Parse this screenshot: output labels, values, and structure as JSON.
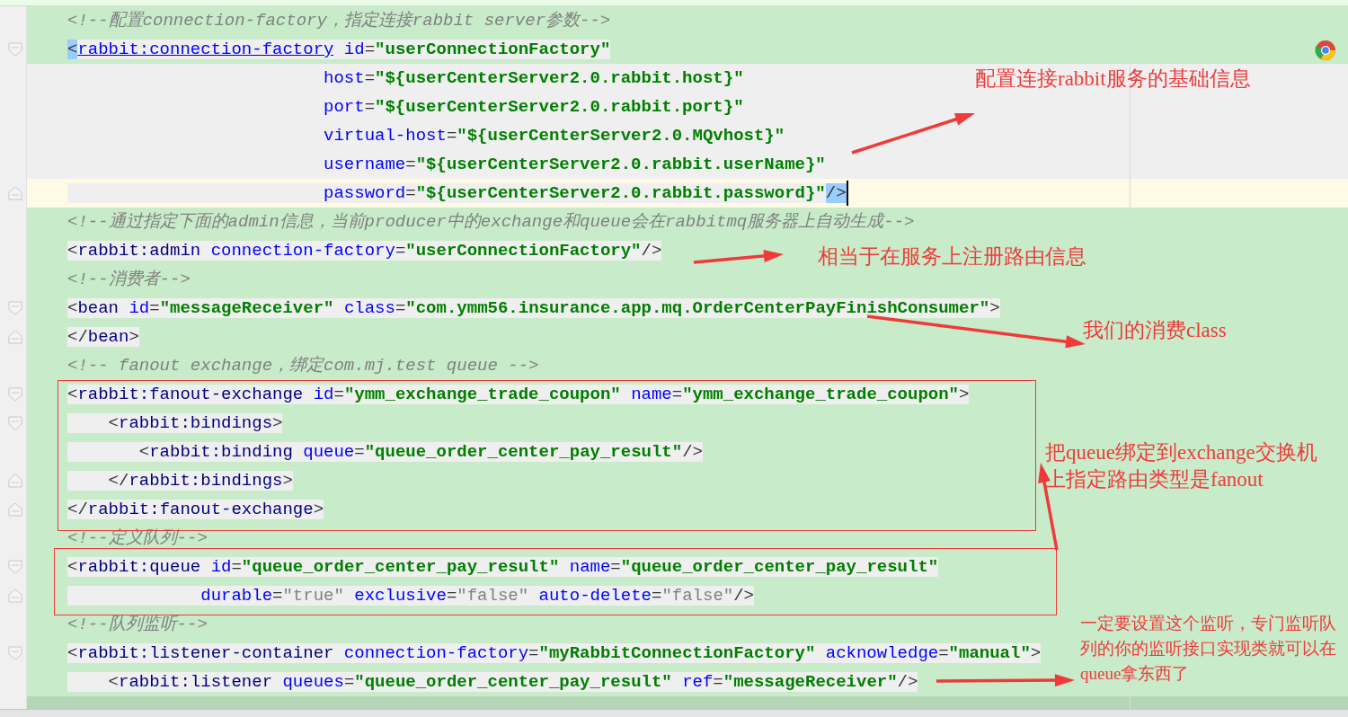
{
  "editor": {
    "lines": [
      {
        "current": false,
        "shaded": false,
        "kind": "plain",
        "tokens": [
          {
            "kind": "comment",
            "text": "<!--配置connection-factory，指定连接rabbit server参数-->"
          }
        ]
      },
      {
        "current": false,
        "shaded": false,
        "kind": "opener",
        "tokens": [
          {
            "kind": "match",
            "text": "<"
          },
          {
            "kind": "link",
            "text": "rabbit:connection-factory"
          },
          {
            "kind": "attr",
            "text": " id"
          },
          {
            "kind": "punct",
            "text": "="
          },
          {
            "kind": "value",
            "text": "\"userConnectionFactory\""
          }
        ]
      },
      {
        "current": false,
        "shaded": true,
        "kind": "plain",
        "tokens": [
          {
            "kind": "attr",
            "text": "                         host"
          },
          {
            "kind": "punct",
            "text": "="
          },
          {
            "kind": "value",
            "text": "\"${userCenterServer2.0.rabbit.host}\""
          }
        ]
      },
      {
        "current": false,
        "shaded": true,
        "kind": "plain",
        "tokens": [
          {
            "kind": "attr",
            "text": "                         port"
          },
          {
            "kind": "punct",
            "text": "="
          },
          {
            "kind": "value",
            "text": "\"${userCenterServer2.0.rabbit.port}\""
          }
        ]
      },
      {
        "current": false,
        "shaded": true,
        "kind": "plain",
        "tokens": [
          {
            "kind": "attr",
            "text": "                         virtual-host"
          },
          {
            "kind": "punct",
            "text": "="
          },
          {
            "kind": "value",
            "text": "\"${userCenterServer2.0.MQvhost}\""
          }
        ]
      },
      {
        "current": false,
        "shaded": true,
        "kind": "plain",
        "tokens": [
          {
            "kind": "attr",
            "text": "                         username"
          },
          {
            "kind": "punct",
            "text": "="
          },
          {
            "kind": "value",
            "text": "\"${userCenterServer2.0.rabbit.userName}\""
          }
        ]
      },
      {
        "current": true,
        "shaded": false,
        "kind": "closer",
        "tokens": [
          {
            "kind": "attr",
            "text": "                         password"
          },
          {
            "kind": "punct",
            "text": "="
          },
          {
            "kind": "value",
            "text": "\"${userCenterServer2.0.rabbit.password}\""
          },
          {
            "kind": "match",
            "text": "/>"
          }
        ]
      },
      {
        "current": false,
        "shaded": false,
        "kind": "plain",
        "tokens": [
          {
            "kind": "comment",
            "text": "<!--通过指定下面的admin信息，当前producer中的exchange和queue会在rabbitmq服务器上自动生成-->"
          }
        ]
      },
      {
        "current": false,
        "shaded": false,
        "kind": "plain",
        "tokens": [
          {
            "kind": "punct",
            "text": "<"
          },
          {
            "kind": "tag",
            "text": "rabbit:admin"
          },
          {
            "kind": "attr",
            "text": " connection-factory"
          },
          {
            "kind": "punct",
            "text": "="
          },
          {
            "kind": "value",
            "text": "\"userConnectionFactory\""
          },
          {
            "kind": "punct",
            "text": "/>"
          }
        ]
      },
      {
        "current": false,
        "shaded": false,
        "kind": "plain",
        "tokens": [
          {
            "kind": "comment",
            "text": "<!--消费者-->"
          }
        ]
      },
      {
        "current": false,
        "shaded": false,
        "kind": "opener",
        "tokens": [
          {
            "kind": "punct",
            "text": "<"
          },
          {
            "kind": "tag",
            "text": "bean"
          },
          {
            "kind": "attr",
            "text": " id"
          },
          {
            "kind": "punct",
            "text": "="
          },
          {
            "kind": "value",
            "text": "\"messageReceiver\""
          },
          {
            "kind": "attr",
            "text": " class"
          },
          {
            "kind": "punct",
            "text": "="
          },
          {
            "kind": "value",
            "text": "\"com.ymm56.insurance.app.mq.OrderCenterPayFinishConsumer\""
          },
          {
            "kind": "punct",
            "text": ">"
          }
        ]
      },
      {
        "current": false,
        "shaded": false,
        "kind": "closer",
        "tokens": [
          {
            "kind": "punct",
            "text": "</"
          },
          {
            "kind": "tag",
            "text": "bean"
          },
          {
            "kind": "punct",
            "text": ">"
          }
        ]
      },
      {
        "current": false,
        "shaded": false,
        "kind": "plain",
        "tokens": [
          {
            "kind": "comment",
            "text": "<!-- fanout exchange，绑定com.mj.test queue -->"
          }
        ]
      },
      {
        "current": false,
        "shaded": false,
        "kind": "opener",
        "tokens": [
          {
            "kind": "punct",
            "text": "<"
          },
          {
            "kind": "tag",
            "text": "rabbit:fanout-exchange"
          },
          {
            "kind": "attr",
            "text": " id"
          },
          {
            "kind": "punct",
            "text": "="
          },
          {
            "kind": "value",
            "text": "\"ymm_exchange_trade_coupon\""
          },
          {
            "kind": "attr",
            "text": " name"
          },
          {
            "kind": "punct",
            "text": "="
          },
          {
            "kind": "value",
            "text": "\"ymm_exchange_trade_coupon\""
          },
          {
            "kind": "punct",
            "text": ">"
          }
        ]
      },
      {
        "current": false,
        "shaded": false,
        "kind": "opener",
        "tokens": [
          {
            "kind": "punct",
            "text": "    <"
          },
          {
            "kind": "tag",
            "text": "rabbit:bindings"
          },
          {
            "kind": "punct",
            "text": ">"
          }
        ]
      },
      {
        "current": false,
        "shaded": false,
        "kind": "plain",
        "tokens": [
          {
            "kind": "punct",
            "text": "       <"
          },
          {
            "kind": "tag",
            "text": "rabbit:binding"
          },
          {
            "kind": "attr",
            "text": " queue"
          },
          {
            "kind": "punct",
            "text": "="
          },
          {
            "kind": "value",
            "text": "\"queue_order_center_pay_result\""
          },
          {
            "kind": "punct",
            "text": "/>"
          }
        ]
      },
      {
        "current": false,
        "shaded": false,
        "kind": "closer",
        "tokens": [
          {
            "kind": "punct",
            "text": "    </"
          },
          {
            "kind": "tag",
            "text": "rabbit:bindings"
          },
          {
            "kind": "punct",
            "text": ">"
          }
        ]
      },
      {
        "current": false,
        "shaded": false,
        "kind": "closer",
        "tokens": [
          {
            "kind": "punct",
            "text": "</"
          },
          {
            "kind": "tag",
            "text": "rabbit:fanout-exchange"
          },
          {
            "kind": "punct",
            "text": ">"
          }
        ]
      },
      {
        "current": false,
        "shaded": false,
        "kind": "plain",
        "tokens": [
          {
            "kind": "comment",
            "text": "<!--定义队列-->"
          }
        ]
      },
      {
        "current": false,
        "shaded": false,
        "kind": "opener",
        "tokens": [
          {
            "kind": "punct",
            "text": "<"
          },
          {
            "kind": "tag",
            "text": "rabbit:queue"
          },
          {
            "kind": "attr",
            "text": " id"
          },
          {
            "kind": "punct",
            "text": "="
          },
          {
            "kind": "value",
            "text": "\"queue_order_center_pay_result\""
          },
          {
            "kind": "attr",
            "text": " name"
          },
          {
            "kind": "punct",
            "text": "="
          },
          {
            "kind": "value",
            "text": "\"queue_order_center_pay_result\""
          }
        ]
      },
      {
        "current": false,
        "shaded": false,
        "kind": "closer",
        "tokens": [
          {
            "kind": "attr",
            "text": "             durable"
          },
          {
            "kind": "punct",
            "text": "="
          },
          {
            "kind": "default",
            "text": "\"true\""
          },
          {
            "kind": "attr",
            "text": " exclusive"
          },
          {
            "kind": "punct",
            "text": "="
          },
          {
            "kind": "default",
            "text": "\"false\""
          },
          {
            "kind": "attr",
            "text": " auto-delete"
          },
          {
            "kind": "punct",
            "text": "="
          },
          {
            "kind": "default",
            "text": "\"false\""
          },
          {
            "kind": "punct",
            "text": "/>"
          }
        ]
      },
      {
        "current": false,
        "shaded": false,
        "kind": "plain",
        "tokens": [
          {
            "kind": "comment",
            "text": "<!--队列监听-->"
          }
        ]
      },
      {
        "current": false,
        "shaded": false,
        "kind": "opener",
        "tokens": [
          {
            "kind": "punct",
            "text": "<"
          },
          {
            "kind": "tag",
            "text": "rabbit:listener-container"
          },
          {
            "kind": "attr",
            "text": " connection-factory"
          },
          {
            "kind": "punct",
            "text": "="
          },
          {
            "kind": "value",
            "text": "\"myRabbitConnectionFactory\""
          },
          {
            "kind": "attr",
            "text": " acknowledge"
          },
          {
            "kind": "punct",
            "text": "="
          },
          {
            "kind": "value",
            "text": "\"manual\""
          },
          {
            "kind": "punct",
            "text": ">"
          }
        ]
      },
      {
        "current": false,
        "shaded": false,
        "kind": "plain",
        "tokens": [
          {
            "kind": "punct",
            "text": "    <"
          },
          {
            "kind": "tag",
            "text": "rabbit:listener"
          },
          {
            "kind": "attr",
            "text": " queues"
          },
          {
            "kind": "punct",
            "text": "="
          },
          {
            "kind": "value",
            "text": "\"queue_order_center_pay_result\""
          },
          {
            "kind": "attr",
            "text": " ref"
          },
          {
            "kind": "punct",
            "text": "="
          },
          {
            "kind": "value",
            "text": "\"messageReceiver\""
          },
          {
            "kind": "punct",
            "text": "/>"
          }
        ]
      }
    ]
  },
  "annotations": [
    {
      "text": "配置连接rabbit服务的基础信息"
    },
    {
      "text": "相当于在服务上注册路由信息"
    },
    {
      "text": "我们的消费class"
    },
    {
      "text": "把queue绑定到exchange交换机上指定路由类型是fanout"
    },
    {
      "text": "一定要设置这个监听，专门监听队列的你的监听接口实现类就可以在queue拿东西了"
    }
  ]
}
